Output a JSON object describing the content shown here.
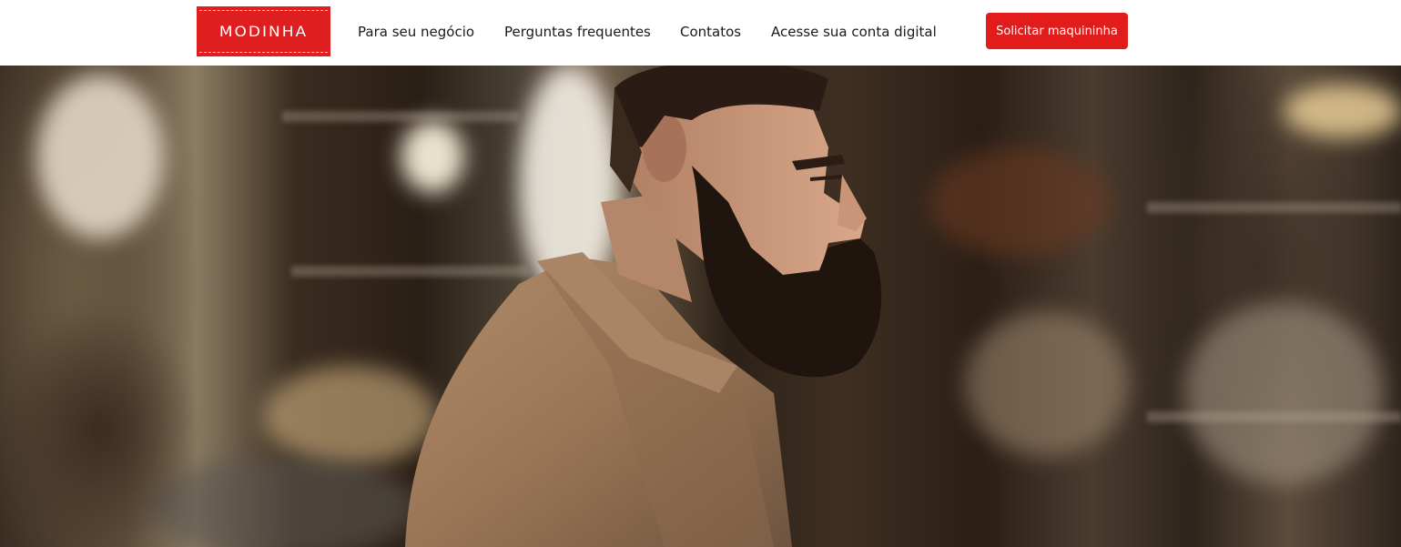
{
  "brand": {
    "name": "MODINHA",
    "color": "#de1e1f"
  },
  "nav": {
    "items": [
      {
        "label": "Para seu negócio"
      },
      {
        "label": "Perguntas frequentes"
      },
      {
        "label": "Contatos"
      },
      {
        "label": "Acesse sua conta digital"
      }
    ],
    "cta_label": "Solicitar maquininha",
    "cta_color": "#e21b1b"
  },
  "hero": {
    "image": "bearded-man-at-bar-counter"
  }
}
